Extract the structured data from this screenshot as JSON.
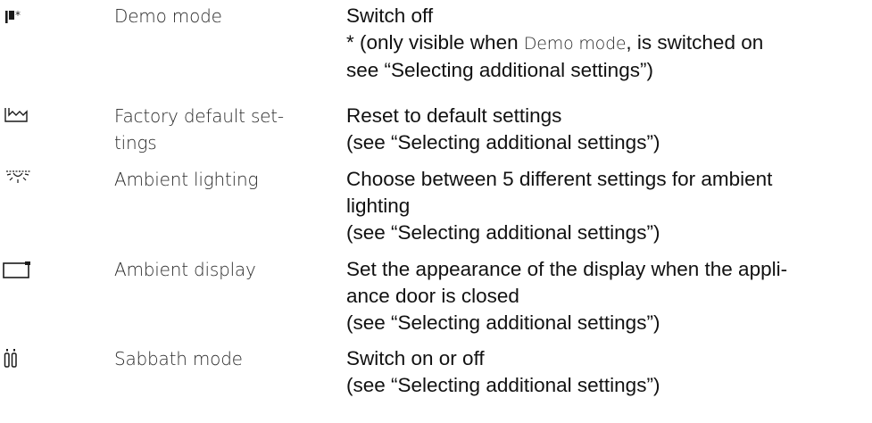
{
  "rows": [
    {
      "icon": "demo-mode-icon",
      "name_lines": [
        "Demo mode"
      ],
      "desc": {
        "line1": "Switch off",
        "line2_before": "* (only visible when ",
        "line2_setting": "Demo mode",
        "line2_after": ", is switched on",
        "line3": "see “Selecting additional settings”)"
      }
    },
    {
      "icon": "factory-default-icon",
      "name_lines": [
        "Factory default set-",
        "tings"
      ],
      "desc_lines": [
        "Reset to default settings",
        "(see “Selecting additional settings”)"
      ]
    },
    {
      "icon": "ambient-lighting-icon",
      "name_lines": [
        "Ambient lighting"
      ],
      "desc_lines": [
        "Choose between 5 different settings for ambient",
        "lighting",
        "(see “Selecting additional settings”)"
      ]
    },
    {
      "icon": "ambient-display-icon",
      "name_lines": [
        "Ambient display"
      ],
      "desc_lines": [
        "Set the appearance of the display when the appli-",
        "ance door is closed",
        "(see “Selecting additional settings”)"
      ]
    },
    {
      "icon": "sabbath-mode-icon",
      "name_lines": [
        "Sabbath mode"
      ],
      "desc_lines": [
        "Switch on or off",
        "(see “Selecting additional settings”)"
      ]
    }
  ]
}
